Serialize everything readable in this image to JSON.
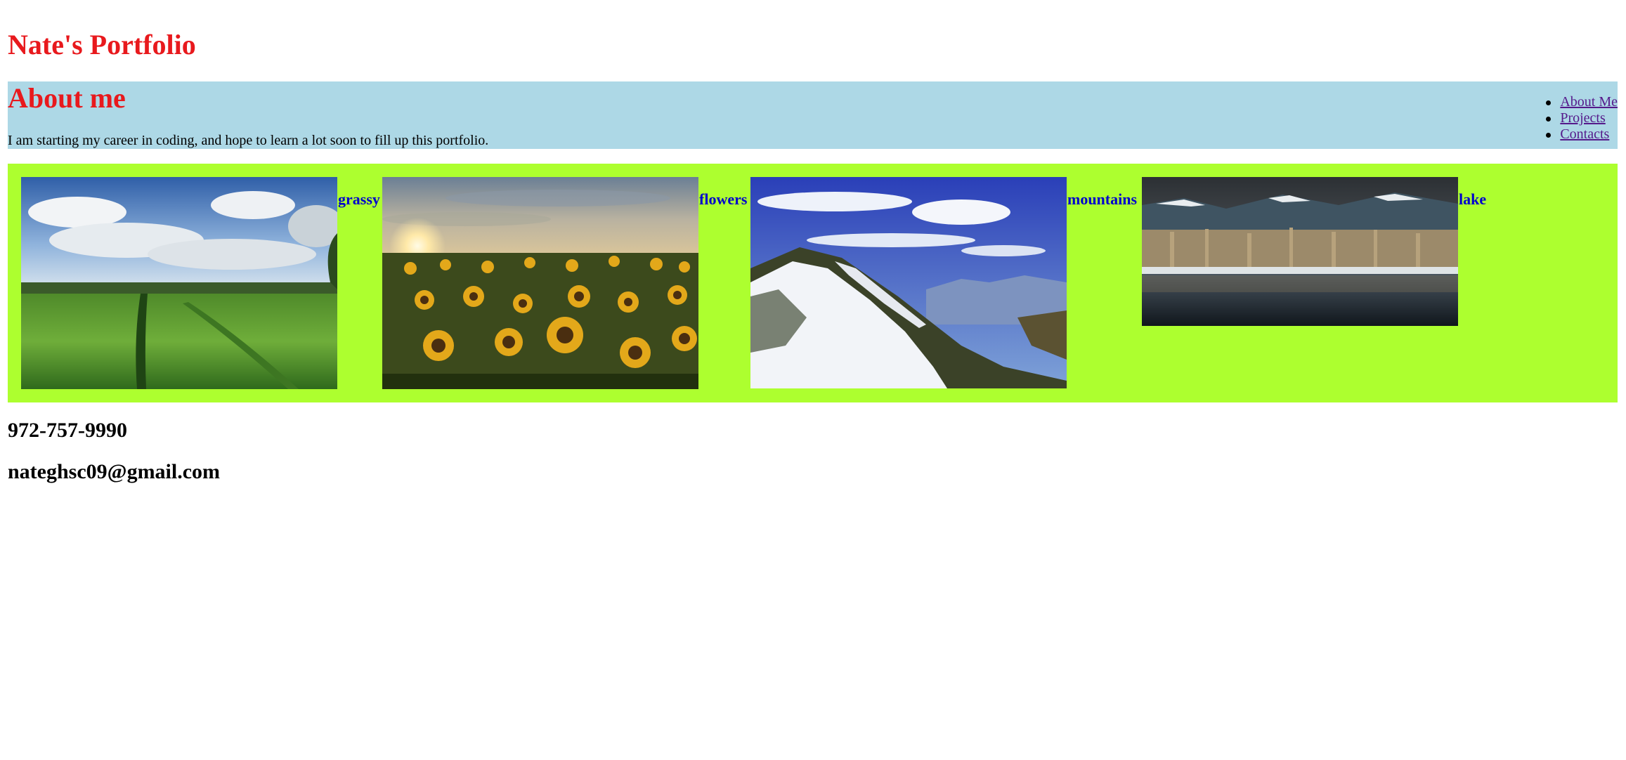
{
  "header": {
    "title": "Nate's Portfolio"
  },
  "about": {
    "heading": "About me",
    "text": "I am starting my career in coding, and hope to learn a lot soon to fill up this portfolio."
  },
  "nav": {
    "items": [
      {
        "label": "About Me"
      },
      {
        "label": "Projects"
      },
      {
        "label": "Contacts"
      }
    ]
  },
  "gallery": {
    "items": [
      {
        "caption": "grassy",
        "image": "grassy-field-image"
      },
      {
        "caption": "flowers",
        "image": "sunflower-field-image"
      },
      {
        "caption": "mountains",
        "image": "snowy-mountain-image"
      },
      {
        "caption": "lake",
        "image": "mountain-lake-image"
      }
    ]
  },
  "contact": {
    "phone": "972-757-9990",
    "email": "nateghsc09@gmail.com"
  },
  "colors": {
    "title_red": "#e8191d",
    "about_bg": "#add8e6",
    "gallery_bg": "#adff2f",
    "caption_blue": "#0000cd",
    "link_visited": "#551a8b"
  }
}
